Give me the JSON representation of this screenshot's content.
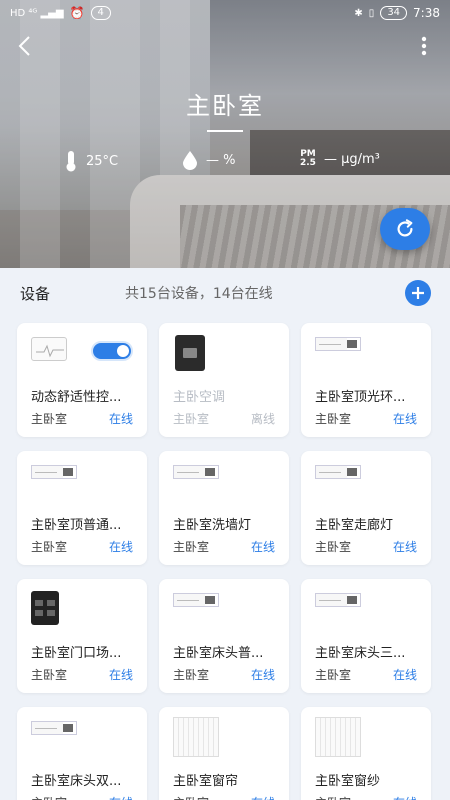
{
  "status_bar": {
    "left_icons": "HD 4G signal alarm",
    "notification_count": "4",
    "battery": "34",
    "time": "7:38"
  },
  "header": {
    "room_title": "主卧室"
  },
  "environment": {
    "temperature": "25°C",
    "humidity": "— %",
    "pm_label_top": "PM",
    "pm_label_bottom": "2.5",
    "pm_value": "— μg/m³"
  },
  "devices_section": {
    "title": "设备",
    "summary": "共15台设备，14台在线"
  },
  "devices": [
    {
      "name": "动态舒适性控...",
      "room": "主卧室",
      "status": "在线",
      "thumb": "sensor",
      "offline": false
    },
    {
      "name": "主卧空调",
      "room": "主卧室",
      "status": "离线",
      "thumb": "ac",
      "offline": true
    },
    {
      "name": "主卧室顶光环...",
      "room": "主卧室",
      "status": "在线",
      "thumb": "panel",
      "offline": false
    },
    {
      "name": "主卧室顶普通...",
      "room": "主卧室",
      "status": "在线",
      "thumb": "panel",
      "offline": false
    },
    {
      "name": "主卧室洗墙灯",
      "room": "主卧室",
      "status": "在线",
      "thumb": "panel",
      "offline": false
    },
    {
      "name": "主卧室走廊灯",
      "room": "主卧室",
      "status": "在线",
      "thumb": "panel",
      "offline": false
    },
    {
      "name": "主卧室门口场...",
      "room": "主卧室",
      "status": "在线",
      "thumb": "scene",
      "offline": false
    },
    {
      "name": "主卧室床头普...",
      "room": "主卧室",
      "status": "在线",
      "thumb": "panel",
      "offline": false
    },
    {
      "name": "主卧室床头三...",
      "room": "主卧室",
      "status": "在线",
      "thumb": "panel",
      "offline": false
    },
    {
      "name": "主卧室床头双...",
      "room": "主卧室",
      "status": "在线",
      "thumb": "panel",
      "offline": false
    },
    {
      "name": "主卧室窗帘",
      "room": "主卧室",
      "status": "在线",
      "thumb": "curtain",
      "offline": false
    },
    {
      "name": "主卧室窗纱",
      "room": "主卧室",
      "status": "在线",
      "thumb": "curtain",
      "offline": false
    }
  ],
  "colors": {
    "accent": "#2d7ee6",
    "background": "#eef2f8",
    "offline_text": "#b7bcc4"
  }
}
